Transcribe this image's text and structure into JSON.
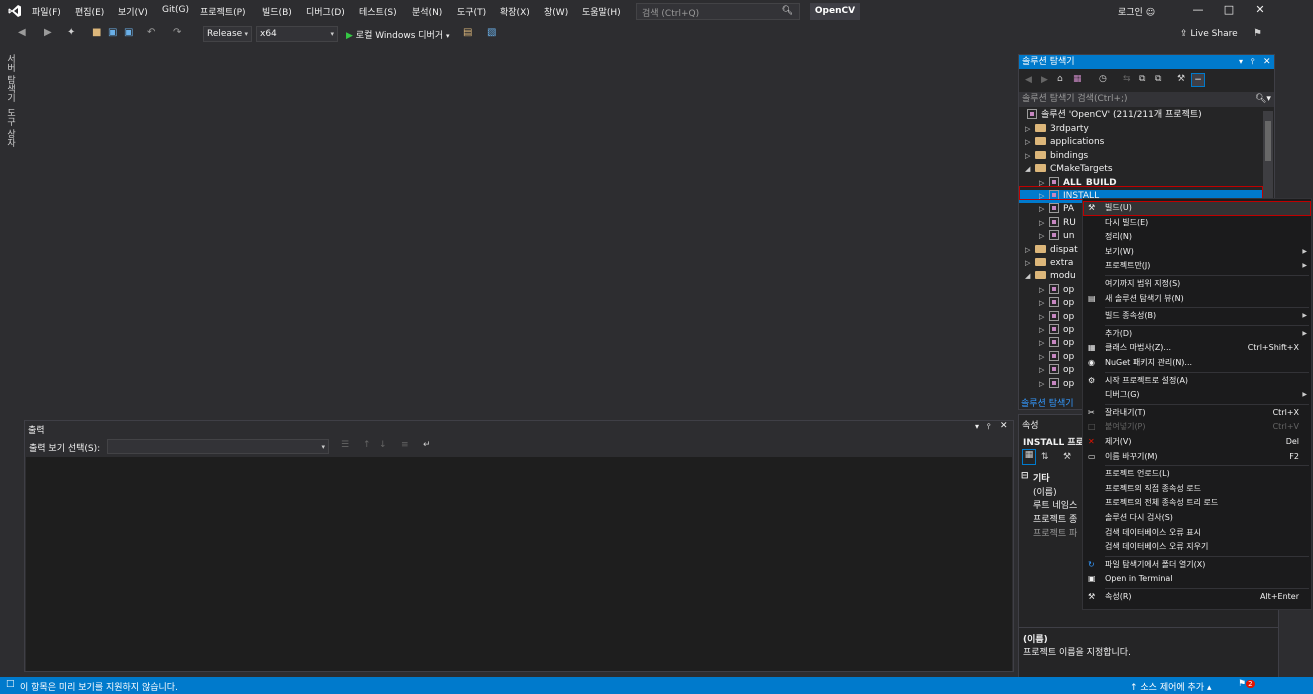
{
  "menu": {
    "items": [
      "파일(F)",
      "편집(E)",
      "보기(V)",
      "Git(G)",
      "프로젝트(P)",
      "빌드(B)",
      "디버그(D)",
      "테스트(S)",
      "분석(N)",
      "도구(T)",
      "확장(X)",
      "창(W)",
      "도움말(H)"
    ],
    "search_placeholder": "검색 (Ctrl+Q)",
    "project_name": "OpenCV",
    "login": "로그인"
  },
  "toolbar": {
    "configuration": "Release",
    "platform": "x64",
    "debugger": "로컬 Windows 디버거",
    "live_share": "Live Share"
  },
  "left_tabs": [
    "서버 탐색기",
    "도구 상자"
  ],
  "output": {
    "title": "출력",
    "show_output_label": "출력 보기 선택(S):",
    "show_output_value": ""
  },
  "solution_explorer": {
    "title": "솔루션 탐색기",
    "search_placeholder": "솔루션 탐색기 검색(Ctrl+;)",
    "solution_label": "솔루션 'OpenCV' (211/211개 프로젝트)",
    "tree": [
      {
        "label": "3rdparty",
        "type": "folder",
        "level": 1,
        "expanded": false
      },
      {
        "label": "applications",
        "type": "folder",
        "level": 1,
        "expanded": false
      },
      {
        "label": "bindings",
        "type": "folder",
        "level": 1,
        "expanded": false
      },
      {
        "label": "CMakeTargets",
        "type": "folder",
        "level": 1,
        "expanded": true
      },
      {
        "label": "ALL_BUILD",
        "type": "project",
        "level": 2,
        "bold": true
      },
      {
        "label": "INSTALL",
        "type": "project",
        "level": 2,
        "selected": true
      },
      {
        "label": "PA",
        "type": "project",
        "level": 2
      },
      {
        "label": "RU",
        "type": "project",
        "level": 2
      },
      {
        "label": "un",
        "type": "project",
        "level": 2
      },
      {
        "label": "dispat",
        "type": "folder",
        "level": 1,
        "expanded": false
      },
      {
        "label": "extra",
        "type": "folder",
        "level": 1,
        "expanded": false
      },
      {
        "label": "modu",
        "type": "folder",
        "level": 1,
        "expanded": true
      },
      {
        "label": "op",
        "type": "project",
        "level": 2
      },
      {
        "label": "op",
        "type": "project",
        "level": 2
      },
      {
        "label": "op",
        "type": "project",
        "level": 2
      },
      {
        "label": "op",
        "type": "project",
        "level": 2
      },
      {
        "label": "op",
        "type": "project",
        "level": 2
      },
      {
        "label": "op",
        "type": "project",
        "level": 2
      },
      {
        "label": "op",
        "type": "project",
        "level": 2
      },
      {
        "label": "op",
        "type": "project",
        "level": 2
      }
    ],
    "bottom_tab": "솔루션 탐색기"
  },
  "properties": {
    "title": "속성",
    "object": "INSTALL 프로",
    "category": "기타",
    "rows": [
      "(이름)",
      "루트 네임스",
      "프로젝트 종",
      "프로젝트 파"
    ],
    "desc_title": "(이름)",
    "desc_text": "프로젝트 이름을 지정합니다."
  },
  "context_menu": {
    "items": [
      {
        "label": "빌드(U)",
        "icon": "build-icon",
        "highlighted": true
      },
      {
        "label": "다시 빌드(E)"
      },
      {
        "label": "정리(N)"
      },
      {
        "label": "보기(W)",
        "submenu": true
      },
      {
        "label": "프로젝트만(J)",
        "submenu": true
      },
      {
        "sep": true
      },
      {
        "label": "여기까지 범위 지정(S)"
      },
      {
        "label": "새 솔루션 탐색기 뷰(N)",
        "icon": "new-view-icon"
      },
      {
        "sep": true
      },
      {
        "label": "빌드 종속성(B)",
        "submenu": true
      },
      {
        "sep": true
      },
      {
        "label": "추가(D)",
        "submenu": true
      },
      {
        "label": "클래스 마법사(Z)...",
        "shortcut": "Ctrl+Shift+X",
        "icon": "class-wizard-icon"
      },
      {
        "label": "NuGet 패키지 관리(N)...",
        "icon": "nuget-icon"
      },
      {
        "sep": true
      },
      {
        "label": "시작 프로젝트로 설정(A)",
        "icon": "gear-icon"
      },
      {
        "label": "디버그(G)",
        "submenu": true
      },
      {
        "sep": true
      },
      {
        "label": "잘라내기(T)",
        "shortcut": "Ctrl+X",
        "icon": "cut-icon"
      },
      {
        "label": "붙여넣기(P)",
        "shortcut": "Ctrl+V",
        "disabled": true,
        "icon": "paste-icon"
      },
      {
        "label": "제거(V)",
        "shortcut": "Del",
        "icon": "remove-icon"
      },
      {
        "label": "이름 바꾸기(M)",
        "shortcut": "F2",
        "icon": "rename-icon"
      },
      {
        "sep": true
      },
      {
        "label": "프로젝트 언로드(L)"
      },
      {
        "label": "프로젝트의 직접 종속성 로드"
      },
      {
        "label": "프로젝트의 전체 종속성 트리 로드"
      },
      {
        "label": "솔루션 다시 검사(S)"
      },
      {
        "label": "검색 데이터베이스 오류 표시"
      },
      {
        "label": "검색 데이터베이스 오류 지우기"
      },
      {
        "sep": true
      },
      {
        "label": "파일 탐색기에서 폴더 열기(X)",
        "icon": "open-folder-icon"
      },
      {
        "label": "Open in Terminal",
        "icon": "terminal-icon"
      },
      {
        "sep": true
      },
      {
        "label": "속성(R)",
        "shortcut": "Alt+Enter",
        "icon": "wrench-icon"
      }
    ]
  },
  "statusbar": {
    "message": "이 항목은 미리 보기를 지원하지 않습니다.",
    "source_control": "소스 제어에 추가",
    "notifications": "2"
  }
}
